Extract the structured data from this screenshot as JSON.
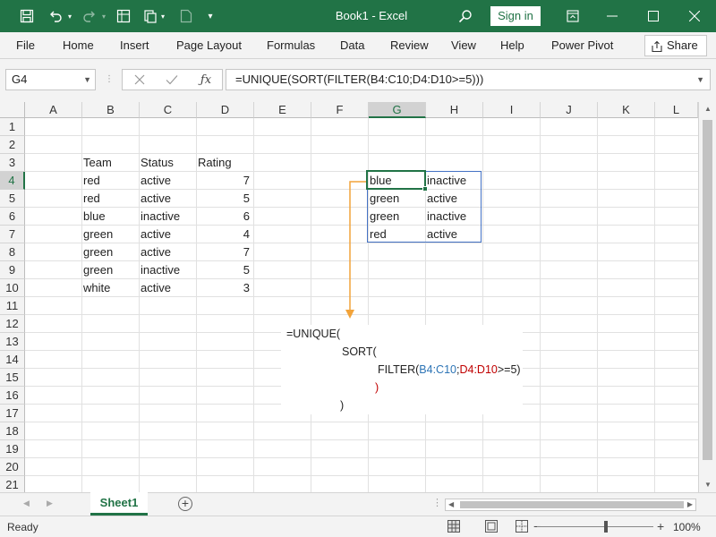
{
  "window": {
    "title": "Book1  -  Excel",
    "signin": "Sign in"
  },
  "ribbon": {
    "tabs": [
      "File",
      "Home",
      "Insert",
      "Page Layout",
      "Formulas",
      "Data",
      "Review",
      "View",
      "Help",
      "Power Pivot"
    ],
    "share": "Share"
  },
  "formula_bar": {
    "name_box": "G4",
    "formula": "=UNIQUE(SORT(FILTER(B4:C10;D4:D10>=5)))"
  },
  "columns": [
    "A",
    "B",
    "C",
    "D",
    "E",
    "F",
    "G",
    "H",
    "I",
    "J",
    "K",
    "L"
  ],
  "rows": [
    "1",
    "2",
    "3",
    "4",
    "5",
    "6",
    "7",
    "8",
    "9",
    "10",
    "11",
    "12",
    "13",
    "14",
    "15",
    "16",
    "17",
    "18",
    "19",
    "20",
    "21"
  ],
  "selected": {
    "column": "G",
    "row": "4"
  },
  "table": {
    "headers": [
      "Team",
      "Status",
      "Rating"
    ],
    "rows": [
      [
        "red",
        "active",
        "7"
      ],
      [
        "red",
        "active",
        "5"
      ],
      [
        "blue",
        "inactive",
        "6"
      ],
      [
        "green",
        "active",
        "4"
      ],
      [
        "green",
        "active",
        "7"
      ],
      [
        "green",
        "inactive",
        "5"
      ],
      [
        "white",
        "active",
        "3"
      ]
    ]
  },
  "result": {
    "rows": [
      [
        "blue",
        "inactive"
      ],
      [
        "green",
        "active"
      ],
      [
        "green",
        "inactive"
      ],
      [
        "red",
        "active"
      ]
    ]
  },
  "explanation": {
    "l1": "=UNIQUE(",
    "l2": "SORT(",
    "l3_fn": "FILTER(",
    "l3_range1": "B4:C10",
    "l3_sep": ";",
    "l3_range2": "D4:D10",
    "l3_cond": ">=5)",
    "l4": ")",
    "l5": ")"
  },
  "sheets": {
    "active": "Sheet1"
  },
  "status": {
    "ready": "Ready",
    "zoom": "100%"
  },
  "colors": {
    "excel_green": "#217346",
    "selection_blue": "#4472c4",
    "annotation_orange": "#f2a33a"
  }
}
